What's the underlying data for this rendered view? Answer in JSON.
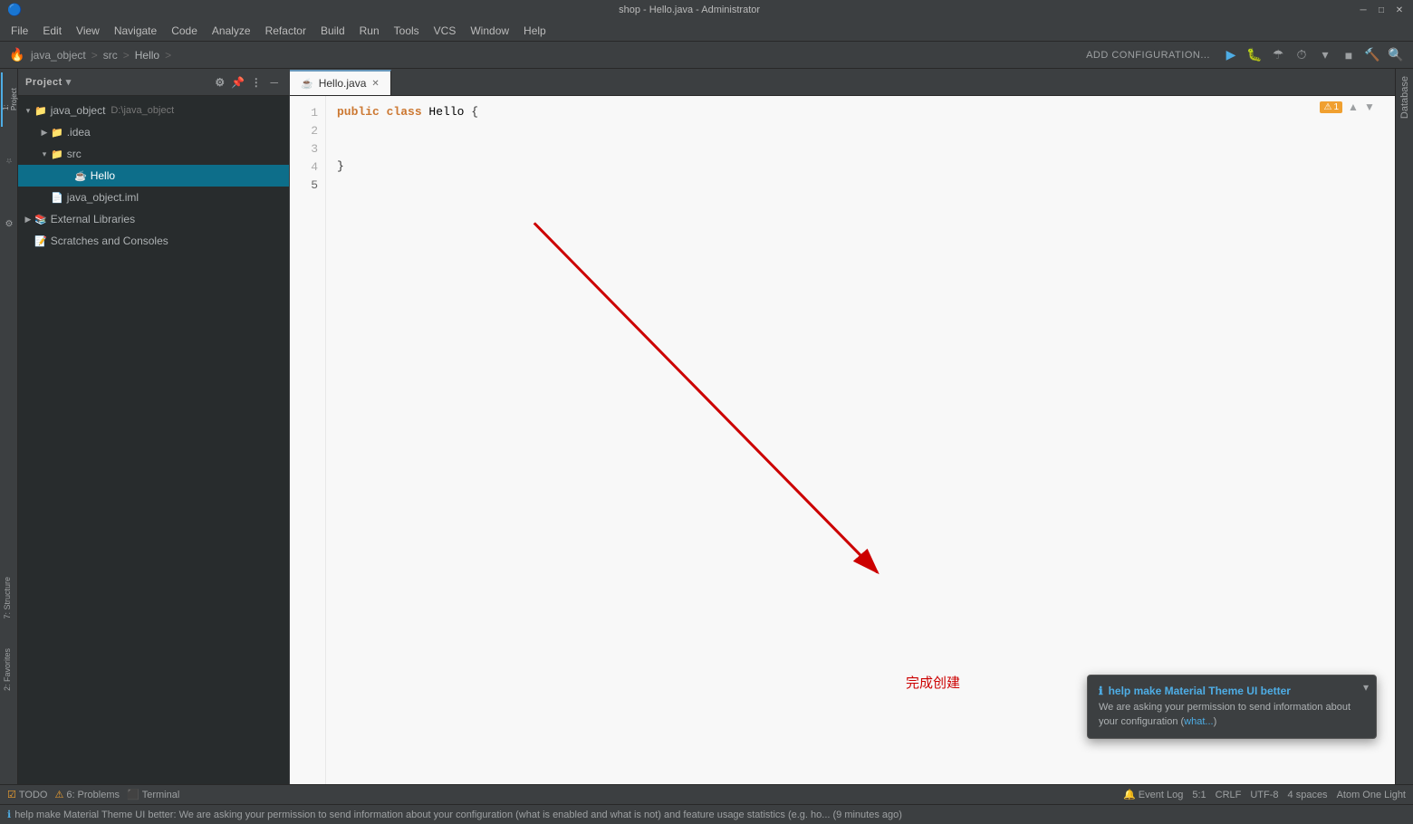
{
  "window": {
    "title": "shop - Hello.java - Administrator",
    "controls": {
      "minimize": "─",
      "maximize": "□",
      "close": "✕"
    }
  },
  "menu": {
    "items": [
      "File",
      "Edit",
      "View",
      "Navigate",
      "Code",
      "Analyze",
      "Refactor",
      "Build",
      "Run",
      "Tools",
      "VCS",
      "Window",
      "Help"
    ]
  },
  "breadcrumb": {
    "items": [
      "java_object",
      "src",
      "Hello"
    ],
    "separators": [
      ">",
      ">"
    ]
  },
  "toolbar": {
    "add_config_label": "ADD CONFIGURATION...",
    "run_icon": "▶",
    "debug_icon": "🐛"
  },
  "project_panel": {
    "title": "Project",
    "root": {
      "name": "java_object",
      "path": "D:\\java_object",
      "children": [
        {
          "name": ".idea",
          "type": "folder",
          "expanded": false
        },
        {
          "name": "src",
          "type": "folder",
          "expanded": true,
          "children": [
            {
              "name": "Hello",
              "type": "java",
              "selected": true
            }
          ]
        },
        {
          "name": "java_object.iml",
          "type": "file"
        },
        {
          "name": "External Libraries",
          "type": "library",
          "expanded": false
        },
        {
          "name": "Scratches and Consoles",
          "type": "scratch",
          "expanded": false
        }
      ]
    }
  },
  "editor": {
    "filename": "Hello.java",
    "tab_icon": "☕",
    "warning_count": "1",
    "lines": [
      {
        "number": "1",
        "content": "public class Hello {"
      },
      {
        "number": "2",
        "content": ""
      },
      {
        "number": "3",
        "content": ""
      },
      {
        "number": "4",
        "content": "}"
      },
      {
        "number": "5",
        "content": ""
      }
    ]
  },
  "annotation": {
    "text": "完成创建",
    "color": "#cc0000"
  },
  "notification": {
    "title": "help make Material Theme UI better",
    "text": "We are asking your permission to send information about your configuration (what...",
    "more_label": "what..."
  },
  "status_bar": {
    "todo_label": "TODO",
    "problems_label": "6: Problems",
    "terminal_label": "Terminal",
    "event_log_label": "Event Log",
    "cursor_position": "5:1",
    "line_endings": "CRLF",
    "encoding": "UTF-8",
    "indent": "4 spaces",
    "theme": "Atom One Light"
  },
  "message_bar": {
    "text": "help make Material Theme UI better: We are asking your permission to send information about your configuration (what is enabled and what is not) and feature usage statistics (e.g. ho... (9 minutes ago)"
  },
  "right_panels": {
    "database_label": "Database"
  },
  "left_activity": {
    "items": [
      "1: Project",
      "7: Structure",
      "2: Favorites"
    ]
  }
}
